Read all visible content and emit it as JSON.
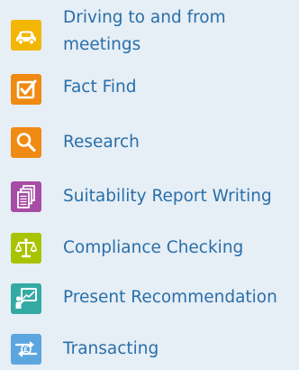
{
  "items": [
    {
      "label": "Driving to and from\nmeetings",
      "icon": "car-icon",
      "color": "#f2b705"
    },
    {
      "label": "Fact Find",
      "icon": "checkbox-icon",
      "color": "#f08a12"
    },
    {
      "label": "Research",
      "icon": "magnifier-icon",
      "color": "#f08a12"
    },
    {
      "label": "Suitability Report Writing",
      "icon": "documents-icon",
      "color": "#a64ca4"
    },
    {
      "label": "Compliance Checking",
      "icon": "scales-icon",
      "color": "#a8c400"
    },
    {
      "label": "Present Recommendation",
      "icon": "presentation-icon",
      "color": "#34aaa4"
    },
    {
      "label": "Transacting",
      "icon": "exchange-icon",
      "color": "#5ca6e0"
    }
  ]
}
